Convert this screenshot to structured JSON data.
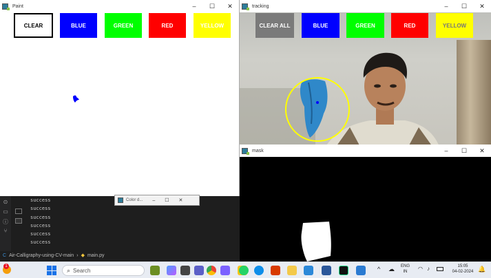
{
  "paint_window": {
    "title": "Paint",
    "controls": [
      "–",
      "☐",
      "✕"
    ],
    "buttons": [
      {
        "label": "CLEAR",
        "bg": "#ffffff",
        "fg": "#000000"
      },
      {
        "label": "BLUE",
        "bg": "#0000ff",
        "fg": "#ffffff"
      },
      {
        "label": "GREEN",
        "bg": "#00ff00",
        "fg": "#ffffff"
      },
      {
        "label": "RED",
        "bg": "#ff0000",
        "fg": "#ffffff"
      },
      {
        "label": "YELLOW",
        "bg": "#ffff00",
        "fg": "#ffffff"
      }
    ]
  },
  "tracking_window": {
    "title": "tracking",
    "controls": [
      "–",
      "☐",
      "✕"
    ],
    "buttons": [
      {
        "label": "CLEAR ALL",
        "bg": "#7a7a7a"
      },
      {
        "label": "BLUE",
        "bg": "#0000ff"
      },
      {
        "label": "GREEN",
        "bg": "#00ff00"
      },
      {
        "label": "RED",
        "bg": "#ff0000"
      },
      {
        "label": "YELLOW",
        "bg": "#ffff00"
      }
    ],
    "tracker_color": "#ffff00"
  },
  "mask_window": {
    "title": "mask",
    "controls": [
      "–",
      "☐",
      "✕"
    ]
  },
  "color_detectors": {
    "title": "Color d...",
    "controls": [
      "–",
      "☐",
      "✕"
    ]
  },
  "terminal": {
    "lines": [
      "success",
      "success",
      "success",
      "success",
      "success",
      "success"
    ]
  },
  "statusbar": {
    "project": "Air-Calligraphy-using-CV-main",
    "file": "main.py"
  },
  "taskbar": {
    "search_placeholder": "Search",
    "language": "ENG",
    "input": "IN",
    "time": "15:05",
    "date": "04-02-2024",
    "notification_badge": "1"
  }
}
